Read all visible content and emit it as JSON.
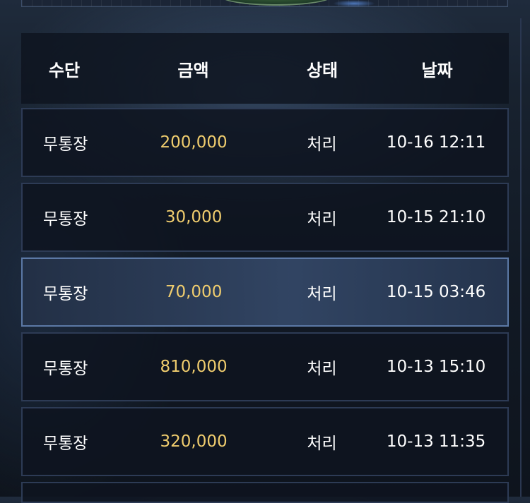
{
  "table": {
    "headers": {
      "method": "수단",
      "amount": "금액",
      "status": "상태",
      "date": "날짜"
    },
    "rows": [
      {
        "method": "무통장",
        "amount": "200,000",
        "status": "처리",
        "date": "10-16 12:11"
      },
      {
        "method": "무통장",
        "amount": "30,000",
        "status": "처리",
        "date": "10-15 21:10"
      },
      {
        "method": "무통장",
        "amount": "70,000",
        "status": "처리",
        "date": "10-15 03:46"
      },
      {
        "method": "무통장",
        "amount": "810,000",
        "status": "처리",
        "date": "10-13 15:10"
      },
      {
        "method": "무통장",
        "amount": "320,000",
        "status": "처리",
        "date": "10-13 11:35"
      }
    ]
  },
  "colors": {
    "amount": "#f0cd6e",
    "text": "#ffffff",
    "row_border": "#2d3b55",
    "highlight_border": "#5c79a6"
  }
}
